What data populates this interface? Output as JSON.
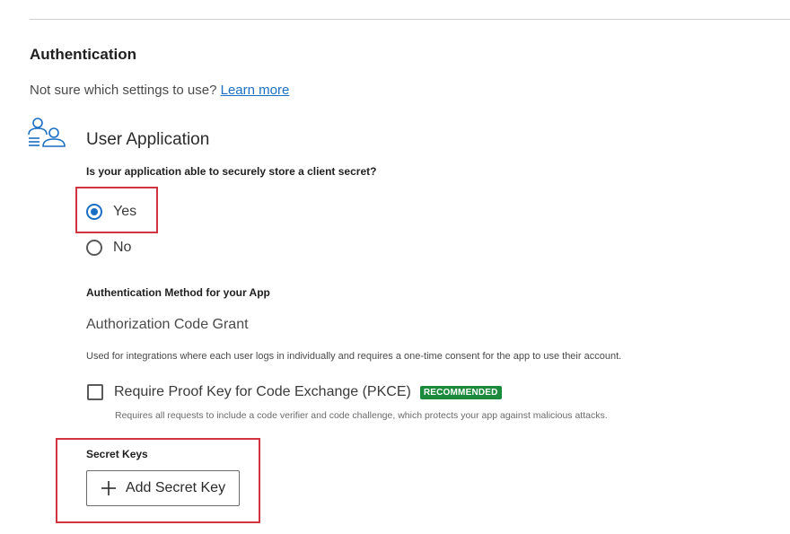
{
  "authentication": {
    "title": "Authentication",
    "helper_text": "Not sure which settings to use?",
    "learn_more": "Learn more"
  },
  "application": {
    "type_label": "User Application",
    "icon": "users-icon"
  },
  "client_secret_question": {
    "label": "Is your application able to securely store a client secret?",
    "options": [
      {
        "label": "Yes",
        "selected": true
      },
      {
        "label": "No",
        "selected": false
      }
    ]
  },
  "auth_method": {
    "heading": "Authentication Method for your App",
    "value": "Authorization Code Grant",
    "description": "Used for integrations where each user logs in individually and requires a one-time consent for the app to use their account."
  },
  "pkce": {
    "label": "Require Proof Key for Code Exchange (PKCE)",
    "badge": "RECOMMENDED",
    "checked": false,
    "description": "Requires all requests to include a code verifier and code challenge, which protects your app against malicious attacks."
  },
  "secret_keys": {
    "heading": "Secret Keys",
    "add_button": "Add Secret Key"
  },
  "colors": {
    "accent": "#1a6fc4",
    "highlight": "#d0343f",
    "badge": "#1c8a3c"
  }
}
